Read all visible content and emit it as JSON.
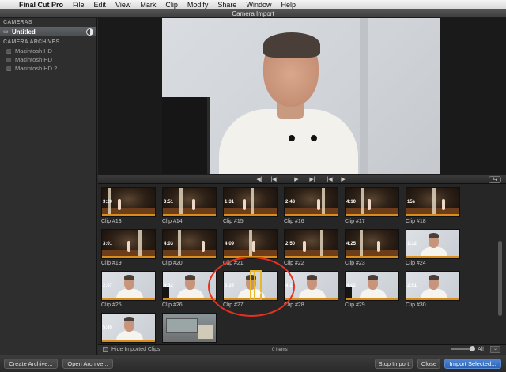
{
  "menubar": {
    "apple_icon": "apple-icon",
    "items": [
      "Final Cut Pro",
      "File",
      "Edit",
      "View",
      "Mark",
      "Clip",
      "Modify",
      "Share",
      "Window",
      "Help"
    ]
  },
  "window": {
    "title": "Camera Import"
  },
  "sidebar": {
    "cameras_header": "CAMERAS",
    "camera_item": "Untitled",
    "archives_header": "CAMERA ARCHIVES",
    "archives": [
      "Macintosh HD",
      "Macintosh HD",
      "Macintosh HD 2"
    ]
  },
  "clips": [
    {
      "name": "Clip #13",
      "duration": "3:20",
      "kind": "stage"
    },
    {
      "name": "Clip #14",
      "duration": "3:51",
      "kind": "stage"
    },
    {
      "name": "Clip #15",
      "duration": "1:31",
      "kind": "stage"
    },
    {
      "name": "Clip #16",
      "duration": "2:48",
      "kind": "stage"
    },
    {
      "name": "Clip #17",
      "duration": "4:10",
      "kind": "stage"
    },
    {
      "name": "Clip #18",
      "duration": "15s",
      "kind": "stage"
    },
    {
      "name": "Clip #19",
      "duration": "3:01",
      "kind": "stage"
    },
    {
      "name": "Clip #20",
      "duration": "4:03",
      "kind": "stage"
    },
    {
      "name": "Clip #21",
      "duration": "4:09",
      "kind": "stage"
    },
    {
      "name": "Clip #22",
      "duration": "2:50",
      "kind": "stage"
    },
    {
      "name": "Clip #23",
      "duration": "4:25",
      "kind": "stage"
    },
    {
      "name": "Clip #24",
      "duration": "1:32",
      "kind": "talk"
    },
    {
      "name": "Clip #25",
      "duration": "2:07",
      "kind": "talk"
    },
    {
      "name": "Clip #26",
      "duration": "4:32",
      "kind": "talk"
    },
    {
      "name": "Clip #27",
      "duration": "3:26",
      "kind": "talk"
    },
    {
      "name": "Clip #28",
      "duration": "4:11",
      "kind": "talk"
    },
    {
      "name": "Clip #29",
      "duration": "4:02",
      "kind": "talk"
    },
    {
      "name": "Clip #30",
      "duration": "2:51",
      "kind": "talk"
    },
    {
      "name": "",
      "duration": "5:45",
      "kind": "talk"
    },
    {
      "name": "",
      "duration": "",
      "kind": "room"
    }
  ],
  "browser_footer": {
    "hide_imported_label": "Hide Imported Clips",
    "item_count": "0 Items",
    "filter_label": "All"
  },
  "bottom_bar": {
    "create_archive": "Create Archive...",
    "open_archive": "Open Archive...",
    "stop_import": "Stop Import",
    "close": "Close",
    "import_selected": "Import Selected..."
  },
  "colors": {
    "accent": "#2f62b3",
    "annotation": "#e4301f",
    "selection": "#e6b82a",
    "clip_stripe": "#d88c1c"
  }
}
